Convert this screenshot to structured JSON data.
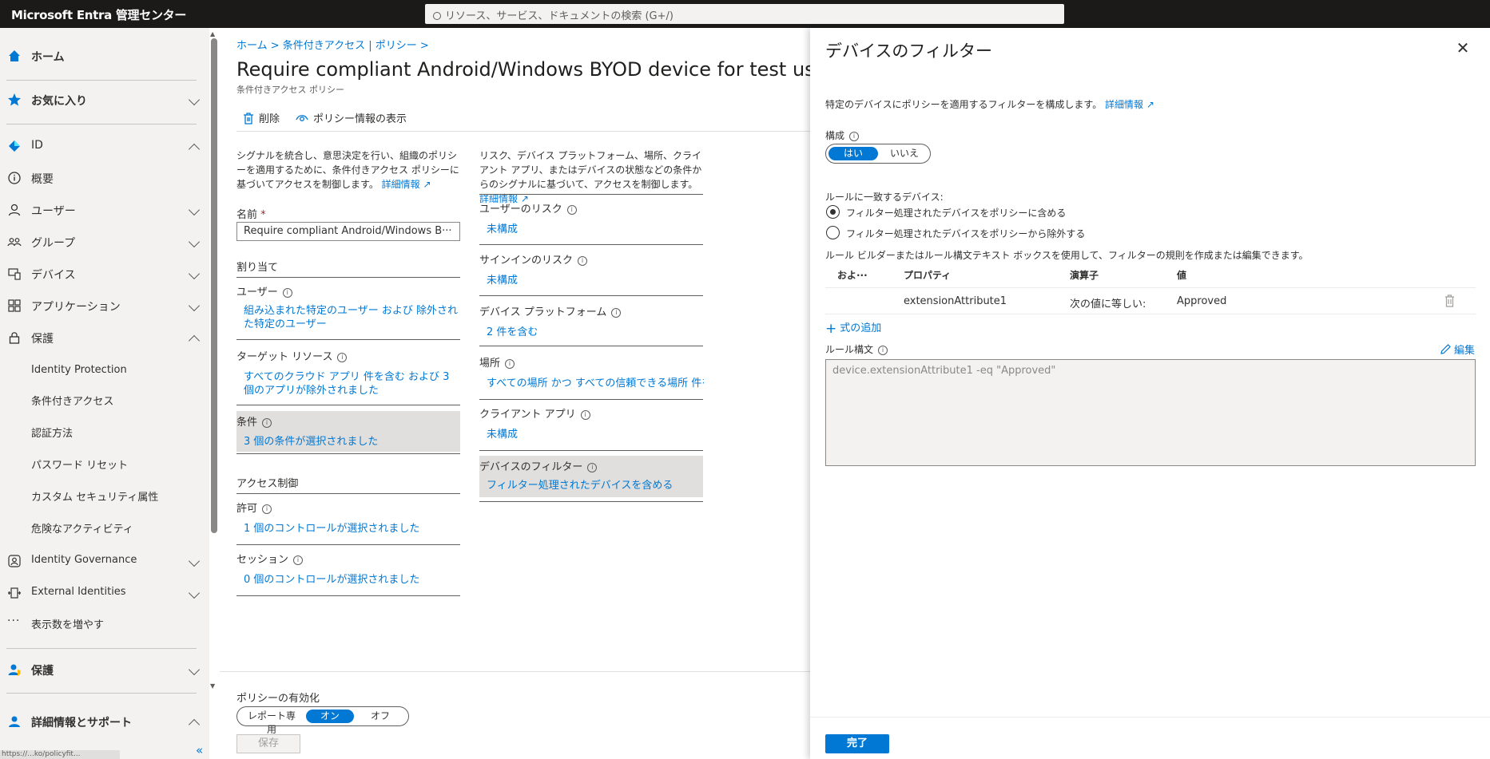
{
  "topbar": {
    "brand": "Microsoft Entra 管理センター",
    "search_placeholder": "リソース、サービス、ドキュメントの検索 (G+/)"
  },
  "sidebar": {
    "home": "ホーム",
    "favorites": "お気に入り",
    "id": "ID",
    "overview": "概要",
    "users": "ユーザー",
    "groups": "グループ",
    "devices": "デバイス",
    "applications": "アプリケーション",
    "protection": "保護",
    "sub_items": [
      "Identity Protection",
      "条件付きアクセス",
      "認証方法",
      "パスワード リセット",
      "カスタム セキュリティ属性",
      "危険なアクティビティ"
    ],
    "identity_governance": "Identity Governance",
    "external_identities": "External Identities",
    "show_more": "表示数を増やす",
    "protection2": "保護",
    "support": "詳細情報とサポート",
    "status_url": "https://...ko/policyfit...",
    "collapse": "«"
  },
  "main": {
    "breadcrumb": "ホーム  >  条件付きアクセス | ポリシー  >",
    "title": "Require compliant Android/Windows BYOD device for test use",
    "subtitle": "条件付きアクセス ポリシー",
    "cmd_delete": "削除",
    "cmd_info": "ポリシー情報の表示",
    "desc_left": "シグナルを統合し、意思決定を行い、組織のポリシーを適用するために、条件付きアクセス ポリシーに基づいてアクセスを制御します。",
    "desc_right": "リスク、デバイス プラットフォーム、場所、クライアント アプリ、またはデバイスの状態などの条件からのシグナルに基づいて、アクセスを制御します。",
    "learn_more": "詳細情報",
    "name_label": "名前",
    "name_value": "Require compliant Android/Windows B···",
    "assignments": "割り当て",
    "users_label": "ユーザー",
    "users_value": "組み込まれた特定のユーザー および 除外された特定のユーザー",
    "target_label": "ターゲット リソース",
    "target_value": "すべてのクラウド アプリ 件を含む および 3 個のアプリが除外されました",
    "conditions_label": "条件",
    "conditions_value": "3 個の条件が選択されました",
    "access_controls": "アクセス制御",
    "grant_label": "許可",
    "grant_value": "1 個のコントロールが選択されました",
    "session_label": "セッション",
    "session_value": "0 個のコントロールが選択されました",
    "user_risk_label": "ユーザーのリスク",
    "user_risk_value": "未構成",
    "signin_risk_label": "サインインのリスク",
    "signin_risk_value": "未構成",
    "platform_label": "デバイス プラットフォーム",
    "platform_value": "2 件を含む",
    "location_label": "場所",
    "location_value": "すべての場所 かつ すべての信頼できる場所 件を除く",
    "client_label": "クライアント アプリ",
    "client_value": "未構成",
    "filter_label": "デバイスのフィルター",
    "filter_value": "フィルター処理されたデバイスを含める",
    "enable_label": "ポリシーの有効化",
    "enable_opts": [
      "レポート専用",
      "オン",
      "オフ"
    ],
    "save": "保存"
  },
  "panel": {
    "title": "デバイスのフィルター",
    "close": "✕",
    "intro": "特定のデバイスにポリシーを適用するフィルターを構成します。",
    "learn_more": "詳細情報",
    "configure_label": "構成",
    "yes": "はい",
    "no": "いいえ",
    "matching_label": "ルールに一致するデバイス:",
    "radio_include": "フィルター処理されたデバイスをポリシーに含める",
    "radio_exclude": "フィルター処理されたデバイスをポリシーから除外する",
    "builder_note": "ルール ビルダーまたはルール構文テキスト ボックスを使用して、フィルターの規則を作成または編集できます。",
    "col_andor": "およ···",
    "col_property": "プロパティ",
    "col_operator": "演算子",
    "col_value": "値",
    "row_property": "extensionAttribute1",
    "row_operator": "次の値に等しい:",
    "row_value": "Approved",
    "add_expression": "式の追加",
    "syntax_label": "ルール構文",
    "edit": "編集",
    "syntax_value": "device.extensionAttribute1 -eq \"Approved\"",
    "done": "完了"
  }
}
